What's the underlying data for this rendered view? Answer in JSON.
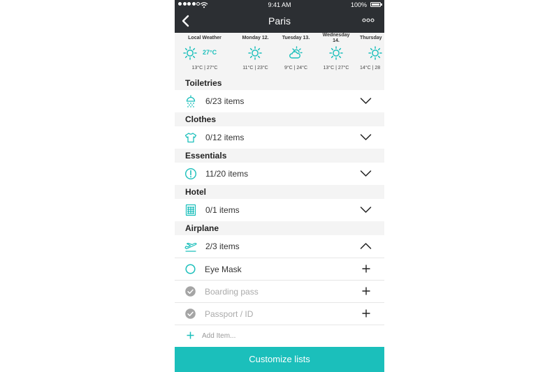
{
  "colors": {
    "accent": "#1bbfbb",
    "bar": "#2c2f33",
    "section_bg": "#f4f4f4"
  },
  "status_bar": {
    "time": "9:41 AM",
    "battery": "100%"
  },
  "nav": {
    "title": "Paris",
    "back_icon": "chevron-left-icon",
    "more_icon": "more-dots-icon"
  },
  "weather": [
    {
      "day": "Local Weather",
      "current": "27°C",
      "range": "13°C | 27°C",
      "icon": "sun-icon"
    },
    {
      "day": "Monday 12.",
      "range": "11°C | 23°C",
      "icon": "sun-icon"
    },
    {
      "day": "Tuesday 13.",
      "range": "9°C | 24°C",
      "icon": "cloud-sun-icon"
    },
    {
      "day": "Wednesday\n14.",
      "range": "13°C | 27°C",
      "icon": "sun-icon"
    },
    {
      "day": "Thursday",
      "range": "14°C | 28",
      "icon": "sun-icon"
    }
  ],
  "categories": [
    {
      "name": "Toiletries",
      "count": "6/23 items",
      "icon": "shower-icon",
      "expanded": false
    },
    {
      "name": "Clothes",
      "count": "0/12 items",
      "icon": "tshirt-icon",
      "expanded": false
    },
    {
      "name": "Essentials",
      "count": "11/20 items",
      "icon": "exclamation-icon",
      "expanded": false
    },
    {
      "name": "Hotel",
      "count": "0/1 items",
      "icon": "hotel-icon",
      "expanded": false
    },
    {
      "name": "Airplane",
      "count": "2/3 items",
      "icon": "airplane-icon",
      "expanded": true
    }
  ],
  "airplane_items": [
    {
      "label": "Eye Mask",
      "checked": false
    },
    {
      "label": "Boarding pass",
      "checked": true
    },
    {
      "label": "Passport / ID",
      "checked": true
    }
  ],
  "add_item": {
    "placeholder": "Add Item..."
  },
  "customize_label": "Customize lists"
}
